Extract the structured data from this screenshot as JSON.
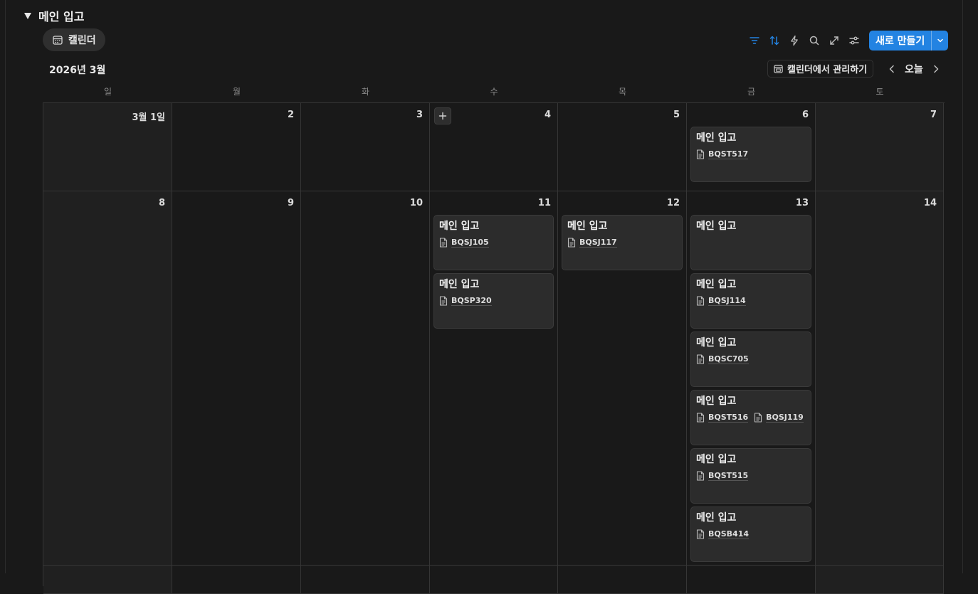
{
  "section": {
    "title": "메인 입고"
  },
  "view_tab": {
    "label": "캘린더",
    "icon": "calendar-icon"
  },
  "toolbar": {
    "icons": [
      "filter-icon",
      "sort-icon",
      "lightning-icon",
      "search-icon",
      "expand-icon",
      "settings-sliders-icon"
    ],
    "new_label": "새로 만들기",
    "accent": "#2383e2"
  },
  "calendar": {
    "month_label": "2026년 3월",
    "manage_label": "캘린더에서 관리하기",
    "today_label": "오늘",
    "weekdays": [
      "일",
      "월",
      "화",
      "수",
      "목",
      "금",
      "토"
    ],
    "weeks": [
      {
        "days": [
          {
            "label": "3월 1일",
            "cards": []
          },
          {
            "label": "2",
            "cards": []
          },
          {
            "label": "3",
            "cards": []
          },
          {
            "label": "4",
            "show_add": true,
            "cards": []
          },
          {
            "label": "5",
            "cards": []
          },
          {
            "label": "6",
            "cards": [
              {
                "title": "메인 입고",
                "relations": [
                  "BQST517"
                ]
              }
            ]
          },
          {
            "label": "7",
            "cards": []
          }
        ]
      },
      {
        "days": [
          {
            "label": "8",
            "cards": []
          },
          {
            "label": "9",
            "cards": []
          },
          {
            "label": "10",
            "cards": []
          },
          {
            "label": "11",
            "cards": [
              {
                "title": "메인 입고",
                "relations": [
                  "BQSJ105"
                ]
              },
              {
                "title": "메인 입고",
                "relations": [
                  "BQSP320"
                ]
              }
            ]
          },
          {
            "label": "12",
            "cards": [
              {
                "title": "메인 입고",
                "relations": [
                  "BQSJ117"
                ]
              }
            ]
          },
          {
            "label": "13",
            "cards": [
              {
                "title": "메인 입고",
                "relations": []
              },
              {
                "title": "메인 입고",
                "relations": [
                  "BQSJ114"
                ]
              },
              {
                "title": "메인 입고",
                "relations": [
                  "BQSC705"
                ]
              },
              {
                "title": "메인 입고",
                "relations": [
                  "BQST516",
                  "BQSJ119"
                ]
              },
              {
                "title": "메인 입고",
                "relations": [
                  "BQST515"
                ]
              },
              {
                "title": "메인 입고",
                "relations": [
                  "BQSB414"
                ]
              }
            ]
          },
          {
            "label": "14",
            "cards": []
          }
        ]
      },
      {
        "days": [
          {
            "label": "",
            "cards": []
          },
          {
            "label": "",
            "cards": []
          },
          {
            "label": "",
            "cards": []
          },
          {
            "label": "",
            "cards": []
          },
          {
            "label": "",
            "cards": []
          },
          {
            "label": "",
            "cards": []
          },
          {
            "label": "",
            "cards": []
          }
        ]
      }
    ]
  }
}
